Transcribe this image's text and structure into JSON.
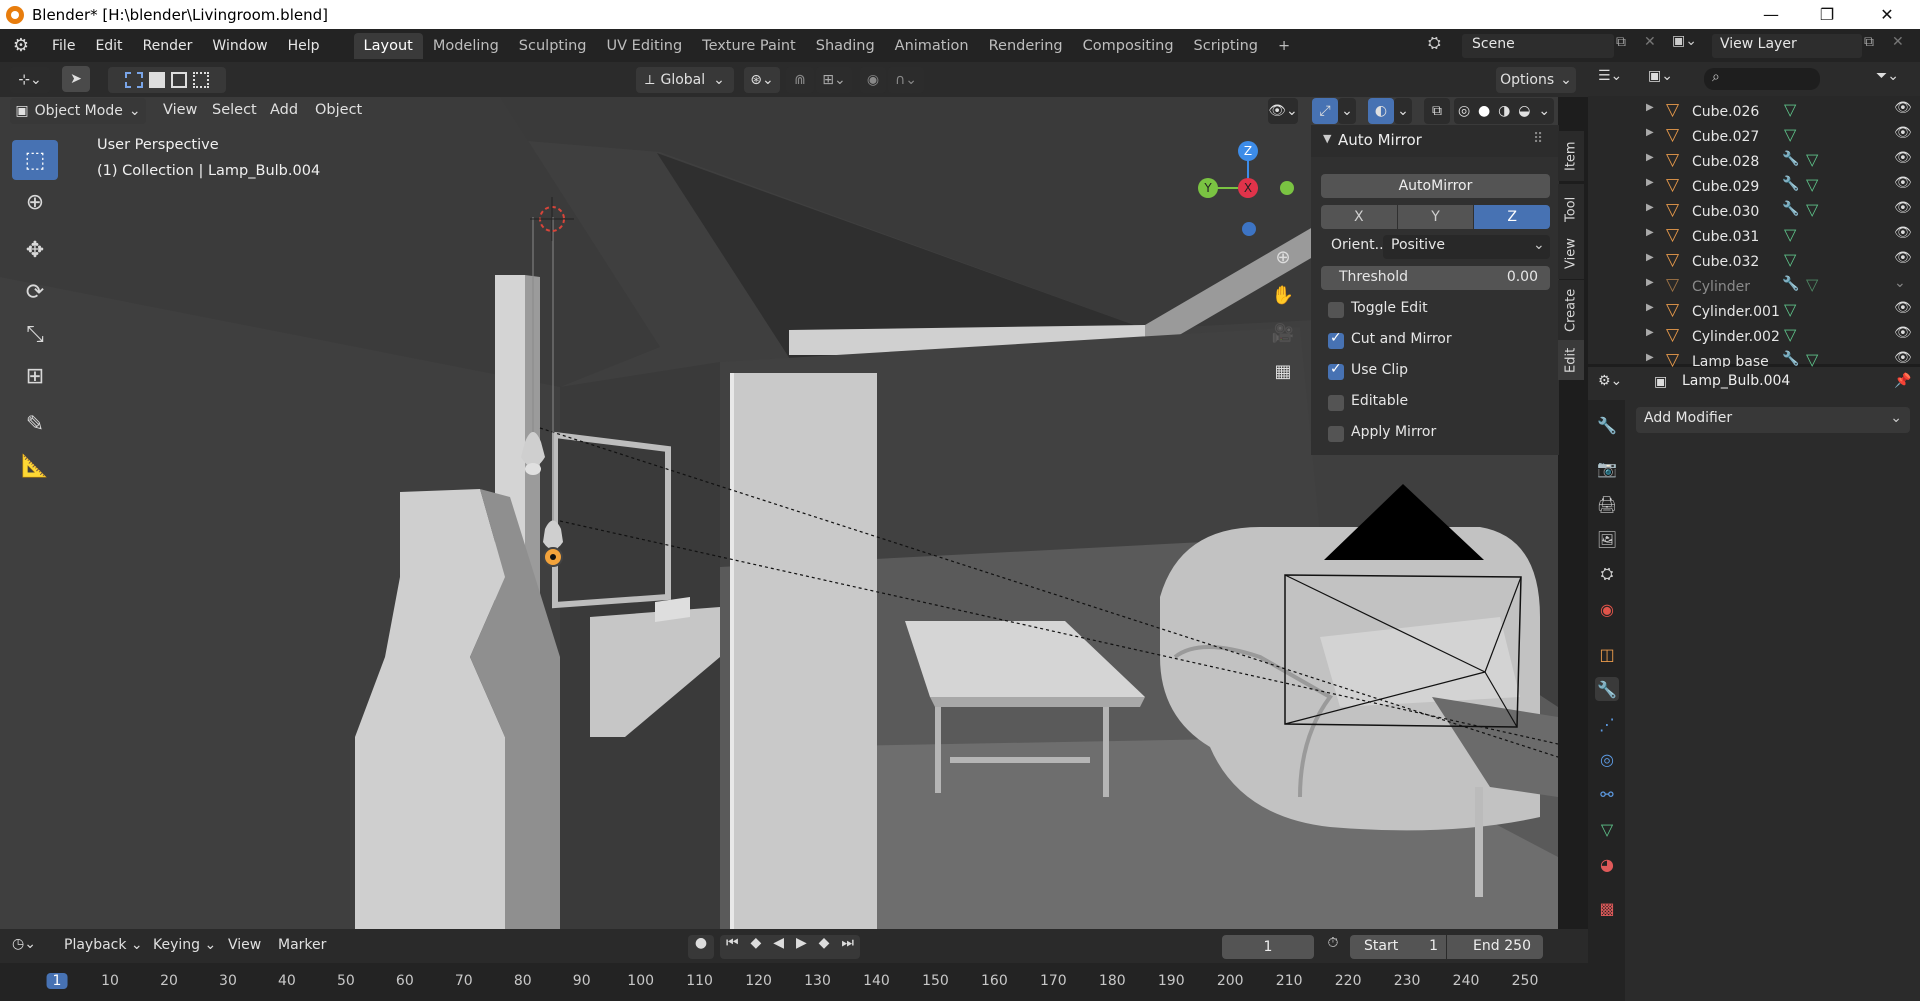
{
  "window": {
    "title": "Blender* [H:\\blender\\Livingroom.blend]",
    "minimize": "—",
    "maximize": "❐",
    "close": "✕"
  },
  "menus": [
    "File",
    "Edit",
    "Render",
    "Window",
    "Help"
  ],
  "workspaces": [
    "Layout",
    "Modeling",
    "Sculpting",
    "UV Editing",
    "Texture Paint",
    "Shading",
    "Animation",
    "Rendering",
    "Compositing",
    "Scripting",
    "+"
  ],
  "scene": {
    "label": "Scene",
    "view_layer": "View Layer"
  },
  "viewport_header": {
    "transform_orientation": "Global",
    "options": "Options",
    "mode": "Object Mode",
    "menus": [
      "View",
      "Select",
      "Add",
      "Object"
    ]
  },
  "overlay_text": {
    "perspective": "User Perspective",
    "collection": "(1) Collection | Lamp_Bulb.004"
  },
  "gizmo": {
    "z": "Z",
    "y": "Y",
    "x": "X",
    "colors": {
      "x": "#e0334a",
      "y": "#7ac342",
      "z": "#3d8ce8"
    }
  },
  "n_panel": {
    "title": "Auto Mirror",
    "button": "AutoMirror",
    "axes": [
      "X",
      "Y",
      "Z"
    ],
    "active_axis": "Z",
    "orientation_label": "Orient..",
    "orientation_value": "Positive",
    "threshold_label": "Threshold",
    "threshold_value": "0.00",
    "options": [
      {
        "label": "Toggle Edit",
        "checked": false
      },
      {
        "label": "Cut and Mirror",
        "checked": true
      },
      {
        "label": "Use Clip",
        "checked": true
      },
      {
        "label": "Editable",
        "checked": false
      },
      {
        "label": "Apply Mirror",
        "checked": false
      }
    ],
    "tabs": [
      "Item",
      "Tool",
      "View",
      "Create",
      "Edit"
    ]
  },
  "outliner": {
    "items": [
      {
        "name": "Cube.026",
        "modifier": false
      },
      {
        "name": "Cube.027",
        "modifier": false
      },
      {
        "name": "Cube.028",
        "modifier": true
      },
      {
        "name": "Cube.029",
        "modifier": true
      },
      {
        "name": "Cube.030",
        "modifier": true
      },
      {
        "name": "Cube.031",
        "modifier": false
      },
      {
        "name": "Cube.032",
        "modifier": false
      },
      {
        "name": "Cylinder",
        "modifier": true
      },
      {
        "name": "Cylinder.001",
        "modifier": false
      },
      {
        "name": "Cylinder.002",
        "modifier": false
      },
      {
        "name": "Lamp base",
        "modifier": true
      }
    ]
  },
  "properties": {
    "object_name": "Lamp_Bulb.004",
    "add_modifier": "Add Modifier"
  },
  "timeline": {
    "menus": [
      "Playback",
      "Keying",
      "View",
      "Marker"
    ],
    "current_frame": "1",
    "start_label": "Start",
    "start": "1",
    "end_label": "End",
    "end": "250",
    "ticks": [
      "1",
      "10",
      "20",
      "30",
      "40",
      "50",
      "60",
      "70",
      "80",
      "90",
      "100",
      "110",
      "120",
      "130",
      "140",
      "150",
      "160",
      "170",
      "180",
      "190",
      "200",
      "210",
      "220",
      "230",
      "240",
      "250"
    ]
  },
  "colors": {
    "accent": "#4772b3",
    "modifier_icon": "#5d9be3",
    "mesh_icon": "#5ec289",
    "object_icon": "#e89a4b"
  }
}
